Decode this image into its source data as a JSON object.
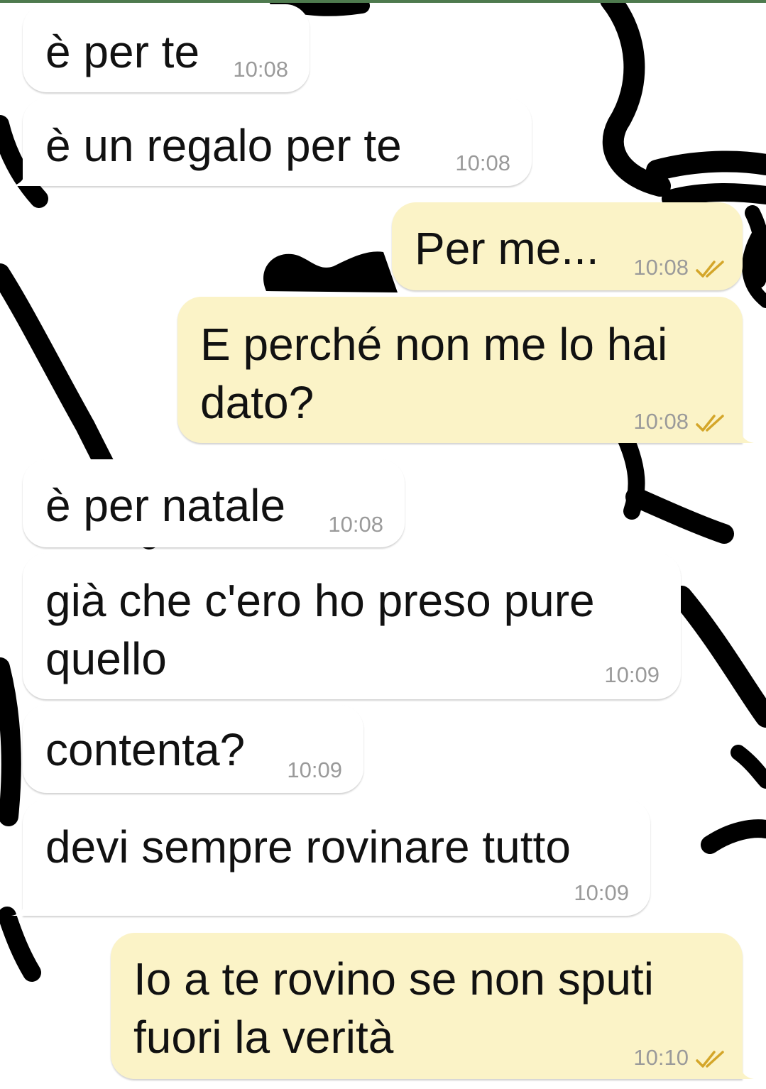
{
  "conversation": {
    "messages": [
      {
        "text": "è per te",
        "time": "10:08",
        "direction": "incoming"
      },
      {
        "text": "è un regalo per te",
        "time": "10:08",
        "direction": "incoming"
      },
      {
        "text": "Per me...",
        "time": "10:08",
        "direction": "outgoing",
        "status_icon": "double-check-icon"
      },
      {
        "text": [
          "E perché non me lo hai",
          "dato?"
        ],
        "time": "10:08",
        "direction": "outgoing",
        "status_icon": "double-check-icon"
      },
      {
        "text": "è per natale",
        "time": "10:08",
        "direction": "incoming"
      },
      {
        "text": [
          "già che c'ero ho preso pure",
          "quello"
        ],
        "time": "10:09",
        "direction": "incoming"
      },
      {
        "text": "contenta?",
        "time": "10:09",
        "direction": "incoming"
      },
      {
        "text": "devi sempre rovinare tutto",
        "time": "10:09",
        "direction": "incoming"
      },
      {
        "text": [
          "Io a te rovino se non sputi",
          "fuori la verità"
        ],
        "time": "10:10",
        "direction": "outgoing",
        "status_icon": "double-check-icon"
      }
    ]
  },
  "colors": {
    "incoming_bubble": "#ffffff",
    "outgoing_bubble": "#fbf3c7",
    "timestamp": "#9a9a9a",
    "read_ticks": "#d4a62a",
    "wallpaper_strokes": "#000000"
  }
}
